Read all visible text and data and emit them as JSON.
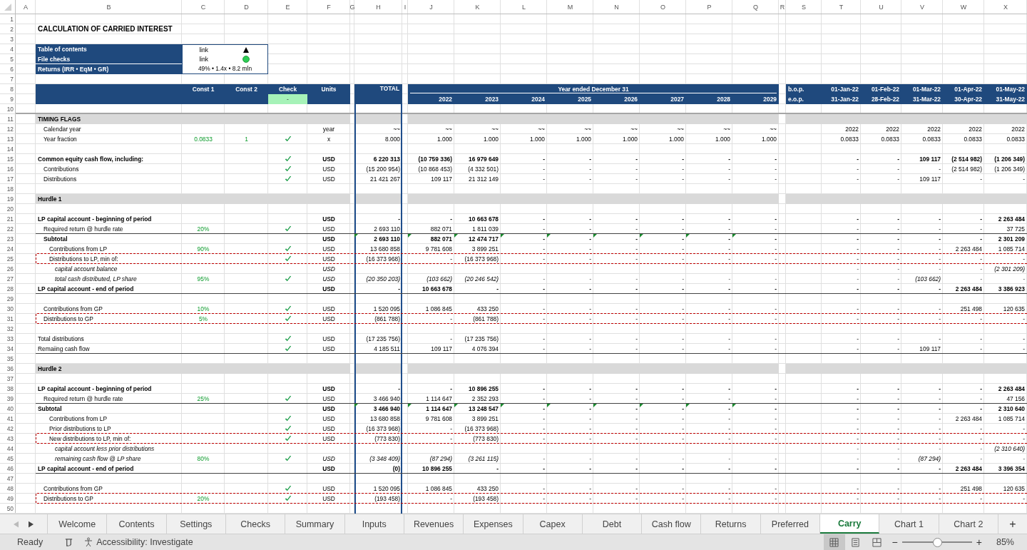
{
  "column_letters": [
    "A",
    "B",
    "C",
    "D",
    "E",
    "F",
    "G",
    "H",
    "I",
    "J",
    "K",
    "L",
    "M",
    "N",
    "O",
    "P",
    "Q",
    "R",
    "S",
    "T",
    "U",
    "V",
    "W",
    "X"
  ],
  "row_numbers": [
    "1",
    "2",
    "3",
    "4",
    "5",
    "6",
    "7",
    "8",
    "9",
    "10",
    "11",
    "12",
    "13",
    "14",
    "15",
    "16",
    "17",
    "18",
    "19",
    "20",
    "21",
    "22",
    "23",
    "24",
    "25",
    "26",
    "27",
    "28",
    "29",
    "30",
    "31",
    "32",
    "33",
    "34",
    "35",
    "36",
    "37",
    "38",
    "39",
    "40",
    "41",
    "42",
    "43",
    "44",
    "45",
    "46",
    "47",
    "48",
    "49",
    "50"
  ],
  "title": "CALCULATION OF CARRIED INTEREST",
  "toc": [
    {
      "label": "Table of contents",
      "value": "link"
    },
    {
      "label": "File checks",
      "value": "link"
    },
    {
      "label": "Returns (IRR • EqM • GR)",
      "value": "49% • 1.4x • 8.2 mln"
    }
  ],
  "header": {
    "const1": "Const 1",
    "const2": "Const 2",
    "check": "Check",
    "check_value": "-",
    "check_ok": true,
    "units": "Units",
    "total": "TOTAL",
    "period_title": "Year ended December 31",
    "years": [
      "2022",
      "2023",
      "2024",
      "2025",
      "2026",
      "2027",
      "2028",
      "2029"
    ],
    "bop": "b.o.p.",
    "eop": "e.o.p.",
    "month_starts": [
      "01-Jan-22",
      "01-Feb-22",
      "01-Mar-22",
      "01-Apr-22",
      "01-May-22"
    ],
    "month_ends": [
      "31-Jan-22",
      "28-Feb-22",
      "31-Mar-22",
      "30-Apr-22",
      "31-May-22"
    ]
  },
  "rows": [
    {
      "kind": "section",
      "label": "TIMING FLAGS"
    },
    {
      "kind": "item",
      "label": "Calendar year",
      "check": false,
      "units": "year",
      "total": "~~",
      "years": [
        "~~",
        "~~",
        "~~",
        "~~",
        "~~",
        "~~",
        "~~",
        "~~"
      ],
      "months": [
        "2022",
        "2022",
        "2022",
        "2022",
        "2022"
      ]
    },
    {
      "kind": "item",
      "label": "Year fraction",
      "const1": "0.0833",
      "const2": "1",
      "check": true,
      "units": "x",
      "total": "8.000",
      "years": [
        "1.000",
        "1.000",
        "1.000",
        "1.000",
        "1.000",
        "1.000",
        "1.000",
        "1.000"
      ],
      "months": [
        "0.0833",
        "0.0833",
        "0.0833",
        "0.0833",
        "0.0833"
      ]
    },
    {
      "kind": "blank"
    },
    {
      "kind": "bold",
      "label": "Common equity cash flow, including:",
      "check": true,
      "units": "USD",
      "total": "6 220 313",
      "years": [
        "(10 759 336)",
        "16 979 649",
        "-",
        "-",
        "-",
        "-",
        "-",
        "-"
      ],
      "months": [
        "-",
        "-",
        "109 117",
        "(2 514 982)",
        "(1 206 349)"
      ]
    },
    {
      "kind": "item",
      "label": "Contributions",
      "check": true,
      "units": "USD",
      "total": "(15 200 954)",
      "years": [
        "(10 868 453)",
        "(4 332 501)",
        "-",
        "-",
        "-",
        "-",
        "-",
        "-"
      ],
      "months": [
        "-",
        "-",
        "-",
        "(2 514 982)",
        "(1 206 349)"
      ]
    },
    {
      "kind": "item",
      "label": "Distributions",
      "check": true,
      "units": "USD",
      "total": "21 421 267",
      "years": [
        "109 117",
        "21 312 149",
        "-",
        "-",
        "-",
        "-",
        "-",
        "-"
      ],
      "months": [
        "-",
        "-",
        "109 117",
        "-",
        "-"
      ]
    },
    {
      "kind": "blank"
    },
    {
      "kind": "section",
      "label": "Hurdle 1"
    },
    {
      "kind": "blank"
    },
    {
      "kind": "bold",
      "label": "LP capital account - beginning of period",
      "check": false,
      "units": "USD",
      "total": "-",
      "years": [
        "-",
        "10 663 678",
        "-",
        "-",
        "-",
        "-",
        "-",
        "-"
      ],
      "months": [
        "-",
        "-",
        "-",
        "-",
        "2 263 484"
      ]
    },
    {
      "kind": "item",
      "label": "Required return @ hurdle rate",
      "const1": "20%",
      "check": true,
      "units": "USD",
      "total": "2 693 110",
      "years": [
        "882 071",
        "1 811 039",
        "-",
        "-",
        "-",
        "-",
        "-",
        "-"
      ],
      "months": [
        "-",
        "-",
        "-",
        "-",
        "37 725"
      ]
    },
    {
      "kind": "subtotal",
      "label": "Subtotal",
      "check": false,
      "units": "USD",
      "total": "2 693 110",
      "years": [
        "882 071",
        "12 474 717",
        "-",
        "-",
        "-",
        "-",
        "-",
        "-"
      ],
      "months": [
        "-",
        "-",
        "-",
        "-",
        "2 301 209"
      ],
      "flags": true
    },
    {
      "kind": "subitem",
      "label": "Contributions from LP",
      "const1": "90%",
      "check": true,
      "units": "USD",
      "total": "13 680 858",
      "years": [
        "9 781 608",
        "3 899 251",
        "-",
        "-",
        "-",
        "-",
        "-",
        "-"
      ],
      "months": [
        "-",
        "-",
        "-",
        "2 263 484",
        "1 085 714"
      ]
    },
    {
      "kind": "subitem",
      "label": "Distributions to LP, min of:",
      "check": true,
      "units": "USD",
      "total": "(16 373 968)",
      "years": [
        "-",
        "(16 373 968)",
        "-",
        "-",
        "-",
        "-",
        "-",
        "-"
      ],
      "months": [
        "-",
        "-",
        "-",
        "-",
        "-"
      ]
    },
    {
      "kind": "note",
      "label": "capital account balance",
      "check": false,
      "units": "USD",
      "months": [
        "-",
        "-",
        "-",
        "-",
        "(2 301 209)"
      ]
    },
    {
      "kind": "note",
      "label": "total cash distributed, LP share",
      "const1": "95%",
      "check": true,
      "units": "USD",
      "total": "(20 350 203)",
      "years": [
        "(103 662)",
        "(20 246 542)",
        "-",
        "-",
        "-",
        "-",
        "-",
        "-"
      ],
      "months": [
        "-",
        "-",
        "(103 662)",
        "-",
        "-"
      ]
    },
    {
      "kind": "bold",
      "label": "LP capital account - end of period",
      "check": false,
      "units": "USD",
      "total": "-",
      "years": [
        "10 663 678",
        "-",
        "-",
        "-",
        "-",
        "-",
        "-",
        "-"
      ],
      "months": [
        "-",
        "-",
        "-",
        "2 263 484",
        "3 386 923"
      ]
    },
    {
      "kind": "blank"
    },
    {
      "kind": "item",
      "label": "Contributions from GP",
      "const1": "10%",
      "check": true,
      "units": "USD",
      "total": "1 520 095",
      "years": [
        "1 086 845",
        "433 250",
        "-",
        "-",
        "-",
        "-",
        "-",
        "-"
      ],
      "months": [
        "-",
        "-",
        "-",
        "251 498",
        "120 635"
      ]
    },
    {
      "kind": "item",
      "label": "Distributions to GP",
      "const1": "5%",
      "check": true,
      "units": "USD",
      "total": "(861 788)",
      "years": [
        "-",
        "(861 788)",
        "-",
        "-",
        "-",
        "-",
        "-",
        "-"
      ],
      "months": [
        "-",
        "-",
        "-",
        "-",
        "-"
      ]
    },
    {
      "kind": "blank"
    },
    {
      "kind": "line",
      "label": "Total distributions",
      "check": true,
      "units": "USD",
      "total": "(17 235 756)",
      "years": [
        "-",
        "(17 235 756)",
        "-",
        "-",
        "-",
        "-",
        "-",
        "-"
      ],
      "months": [
        "-",
        "-",
        "-",
        "-",
        "-"
      ]
    },
    {
      "kind": "line",
      "label": "Remaiing cash flow",
      "check": true,
      "units": "USD",
      "total": "4 185 511",
      "years": [
        "109 117",
        "4 076 394",
        "-",
        "-",
        "-",
        "-",
        "-",
        "-"
      ],
      "months": [
        "-",
        "-",
        "109 117",
        "-",
        "-"
      ]
    },
    {
      "kind": "blank"
    },
    {
      "kind": "section",
      "label": "Hurdle 2"
    },
    {
      "kind": "blank"
    },
    {
      "kind": "bold",
      "label": "LP capital account - beginning of period",
      "check": false,
      "units": "USD",
      "total": "-",
      "years": [
        "-",
        "10 896 255",
        "-",
        "-",
        "-",
        "-",
        "-",
        "-"
      ],
      "months": [
        "-",
        "-",
        "-",
        "-",
        "2 263 484"
      ]
    },
    {
      "kind": "item",
      "label": "Required return @ hurdle rate",
      "const1": "25%",
      "check": true,
      "units": "USD",
      "total": "3 466 940",
      "years": [
        "1 114 647",
        "2 352 293",
        "-",
        "-",
        "-",
        "-",
        "-",
        "-"
      ],
      "months": [
        "-",
        "-",
        "-",
        "-",
        "47 156"
      ]
    },
    {
      "kind": "bold",
      "label": "Subtotal",
      "check": false,
      "units": "USD",
      "total": "3 466 940",
      "years": [
        "1 114 647",
        "13 248 547",
        "-",
        "-",
        "-",
        "-",
        "-",
        "-"
      ],
      "months": [
        "-",
        "-",
        "-",
        "-",
        "2 310 640"
      ],
      "flags": true
    },
    {
      "kind": "subitem",
      "label": "Contributions from LP",
      "check": true,
      "units": "USD",
      "total": "13 680 858",
      "years": [
        "9 781 608",
        "3 899 251",
        "-",
        "-",
        "-",
        "-",
        "-",
        "-"
      ],
      "months": [
        "-",
        "-",
        "-",
        "2 263 484",
        "1 085 714"
      ]
    },
    {
      "kind": "subitem",
      "label": "Prior distributions to LP",
      "check": true,
      "units": "USD",
      "total": "(16 373 968)",
      "years": [
        "-",
        "(16 373 968)",
        "-",
        "-",
        "-",
        "-",
        "-",
        "-"
      ],
      "months": [
        "-",
        "-",
        "-",
        "-",
        "-"
      ]
    },
    {
      "kind": "subitem",
      "label": "New distributions to LP, min of:",
      "check": true,
      "units": "USD",
      "total": "(773 830)",
      "years": [
        "-",
        "(773 830)",
        "-",
        "-",
        "-",
        "-",
        "-",
        "-"
      ],
      "months": [
        "-",
        "-",
        "-",
        "-",
        "-"
      ]
    },
    {
      "kind": "note",
      "label": "capital account less prior distributions",
      "check": false,
      "months": [
        "-",
        "-",
        "-",
        "-",
        "(2 310 640)"
      ]
    },
    {
      "kind": "note",
      "label": "remaining cash flow @ LP share",
      "const1": "80%",
      "check": true,
      "units": "USD",
      "total": "(3 348 409)",
      "years": [
        "(87 294)",
        "(3 261 115)",
        "-",
        "-",
        "-",
        "-",
        "-",
        "-"
      ],
      "months": [
        "-",
        "-",
        "(87 294)",
        "-",
        "-"
      ]
    },
    {
      "kind": "bold",
      "label": "LP capital account - end of period",
      "check": false,
      "units": "USD",
      "total": "(0)",
      "years": [
        "10 896 255",
        "-",
        "-",
        "-",
        "-",
        "-",
        "-",
        "-"
      ],
      "months": [
        "-",
        "-",
        "-",
        "2 263 484",
        "3 396 354"
      ]
    },
    {
      "kind": "blank"
    },
    {
      "kind": "item",
      "label": "Contributions from GP",
      "check": true,
      "units": "USD",
      "total": "1 520 095",
      "years": [
        "1 086 845",
        "433 250",
        "-",
        "-",
        "-",
        "-",
        "-",
        "-"
      ],
      "months": [
        "-",
        "-",
        "-",
        "251 498",
        "120 635"
      ]
    },
    {
      "kind": "item",
      "label": "Distributions to GP",
      "const1": "20%",
      "check": true,
      "units": "USD",
      "total": "(193 458)",
      "years": [
        "-",
        "(193 458)",
        "-",
        "-",
        "-",
        "-",
        "-",
        "-"
      ],
      "months": [
        "-",
        "-",
        "-",
        "-",
        "-"
      ]
    },
    {
      "kind": "blank"
    }
  ],
  "sheet_tabs": [
    {
      "label": "Welcome",
      "selected": false
    },
    {
      "label": "Contents",
      "selected": false
    },
    {
      "label": "Settings",
      "selected": false
    },
    {
      "label": "Checks",
      "selected": false
    },
    {
      "label": "Summary",
      "selected": false
    },
    {
      "label": "Inputs",
      "selected": false
    },
    {
      "label": "Revenues",
      "selected": false
    },
    {
      "label": "Expenses",
      "selected": false
    },
    {
      "label": "Capex",
      "selected": false
    },
    {
      "label": "Debt",
      "selected": false
    },
    {
      "label": "Cash flow",
      "selected": false
    },
    {
      "label": "Returns",
      "selected": false
    },
    {
      "label": "Preferred",
      "selected": false
    },
    {
      "label": "Carry",
      "selected": true
    },
    {
      "label": "Chart 1",
      "selected": false
    },
    {
      "label": "Chart 2",
      "selected": false
    }
  ],
  "add_sheet": "+",
  "status_bar": {
    "status": "Ready",
    "accessibility": "Accessibility: Investigate",
    "zoom_out": "−",
    "zoom_in": "+",
    "zoom": "85%",
    "zoom_slider": {
      "level": 0.5
    }
  }
}
